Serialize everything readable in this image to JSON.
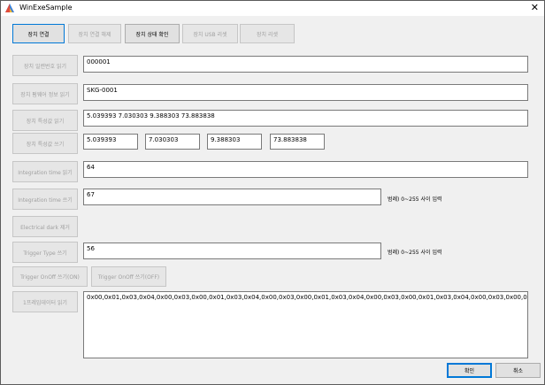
{
  "window": {
    "title": "WinExeSample",
    "close_glyph": "✕",
    "app_icon": "app-icon"
  },
  "toolbar": {
    "connect": "장치 연결",
    "disconnect": "장치 연결 해제",
    "status_check": "장치 상태 확인",
    "usb_reset": "장치 USB 리셋",
    "device_reset": "장치 리셋"
  },
  "rows": {
    "serial": {
      "button": "장치 일련번호 읽기",
      "value": "000001"
    },
    "firmware": {
      "button": "장치 펌웨어 정보 읽기",
      "value": "SKG-0001"
    },
    "char_read": {
      "button": "장치 특성값 읽기",
      "value": "5.039393 7.030303 9.388303 73.883838"
    },
    "char_write": {
      "button": "장치 특성값 쓰기",
      "values": [
        "5.039393",
        "7.030303",
        "9.388303",
        "73.883838"
      ]
    },
    "integ_read": {
      "button": "Integration time 읽기",
      "value": "64"
    },
    "integ_write": {
      "button": "Integration time 쓰기",
      "value": "67",
      "hint": "범례) 0~255 사이 입력"
    },
    "electrical_dark": {
      "button": "Electrical dark 제거"
    },
    "trigger_type": {
      "button": "Trigger Type 쓰기",
      "value": "56",
      "hint": "범례) 0~255 사이 입력"
    },
    "trigger_onoff": {
      "on_button": "Trigger OnOff 쓰기(ON)",
      "off_button": "Trigger OnOff 쓰기(OFF)"
    },
    "frame_read": {
      "button": "1프레임데이터 읽기",
      "value": "0x00,0x01,0x03,0x04,0x00,0x03,0x00,0x01,0x03,0x04,0x00,0x03,0x00,0x01,0x03,0x04,0x00,0x03,0x00,0x01,0x03,0x04,0x00,0x03,0x00,0x01,0x03,0x04,0x00,0x03,0x00"
    }
  },
  "footer": {
    "ok": "확인",
    "cancel": "취소"
  }
}
